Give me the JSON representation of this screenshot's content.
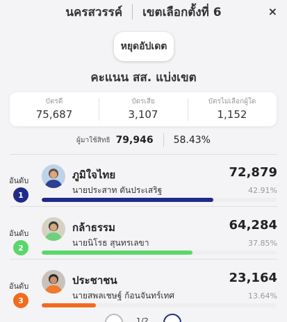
{
  "header": {
    "province": "นครสวรรค์",
    "district": "เขตเลือกตั้งที่ 6",
    "close_icon": "×"
  },
  "pause_button": {
    "label": "หยุดอัปเดต"
  },
  "section_title": "คะแนน สส. แบ่งเขต",
  "stats": [
    {
      "label": "บัตรดี",
      "value": "75,687"
    },
    {
      "label": "บัตรเสีย",
      "value": "3,107"
    },
    {
      "label": "บัตรไม่เลือกผู้ใด",
      "value": "1,152"
    }
  ],
  "turnout": {
    "label": "ผู้มาใช้สิทธิ",
    "value": "79,946",
    "percent": "58.43%"
  },
  "rank_label": "อันดับ",
  "candidates": [
    {
      "rank": "1",
      "party": "ภูมิใจไทย",
      "name": "นายประสาท ตันประเสริฐ",
      "votes": "72,879",
      "percent": "42.91%",
      "share": 0.4291,
      "color": "#1f2a8a",
      "avatar_bg": "#bcd3ea"
    },
    {
      "rank": "2",
      "party": "กล้าธรรม",
      "name": "นายนิโรธ สุนทรเลขา",
      "votes": "64,284",
      "percent": "37.85%",
      "share": 0.3785,
      "color": "#5bd66a",
      "avatar_bg": "#d8d2c2"
    },
    {
      "rank": "3",
      "party": "ประชาชน",
      "name": "นายสพลเชษฐ์ ก้อนจันทร์เทศ",
      "votes": "23,164",
      "percent": "13.64%",
      "share": 0.1364,
      "color": "#f26b1f",
      "avatar_bg": "#c9c2bb"
    }
  ],
  "pager": {
    "text": "1/2"
  }
}
